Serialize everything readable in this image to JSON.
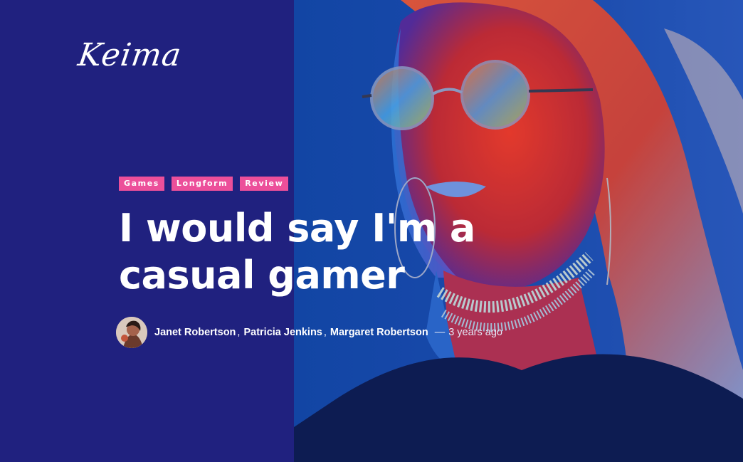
{
  "site": {
    "logo": "Keima"
  },
  "article": {
    "tags": [
      "Games",
      "Longform",
      "Review"
    ],
    "title": "I would say I'm a casual gamer",
    "authors": [
      "Janet Robertson",
      "Patricia Jenkins",
      "Margaret Robertson"
    ],
    "author_separator": ",",
    "date_separator": "—",
    "published": "3 years ago"
  },
  "icons": {
    "avatar": "author-avatar"
  },
  "colors": {
    "background": "#20217f",
    "tag_background": "#ec4f9a",
    "text": "#ffffff"
  }
}
